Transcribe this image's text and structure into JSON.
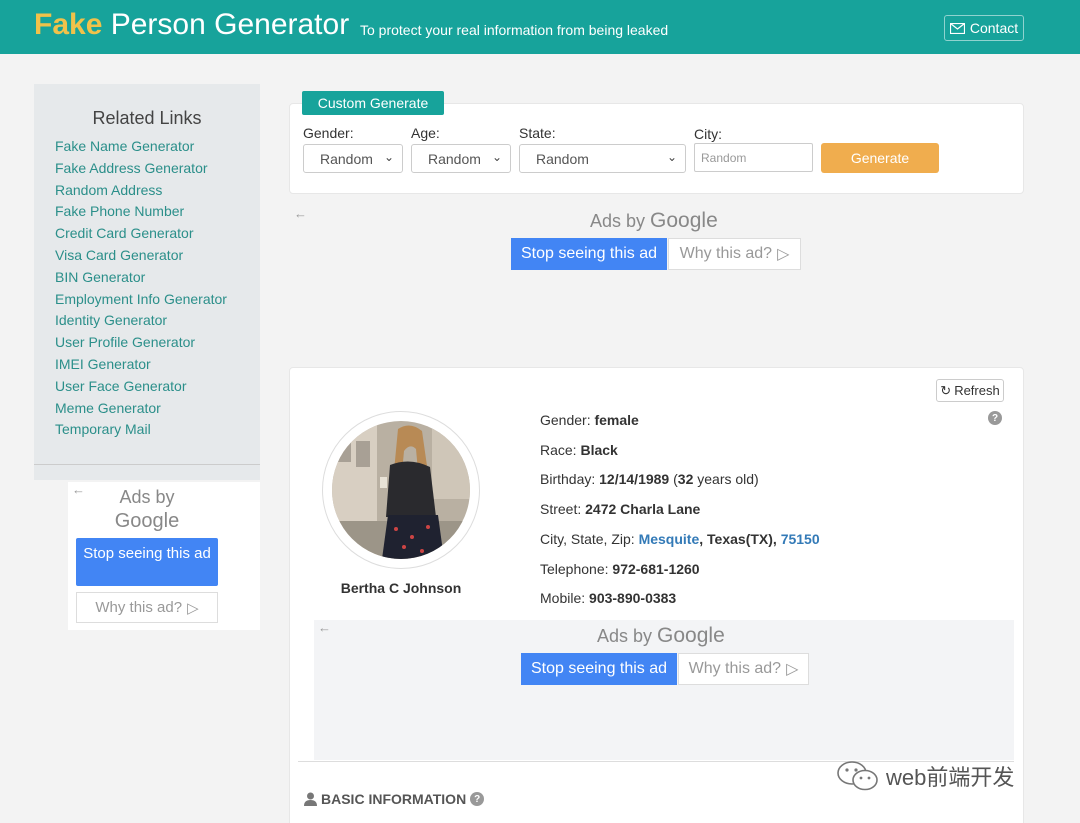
{
  "header": {
    "brand_fake": "Fake",
    "brand_rest": " Person Generator",
    "tagline": "To protect your real information from being leaked",
    "contact_label": "Contact"
  },
  "sidebar": {
    "title": "Related Links",
    "links": [
      "Fake Name Generator",
      "Fake Address Generator",
      "Random Address",
      "Fake Phone Number",
      "Credit Card Generator",
      "Visa Card Generator",
      "BIN Generator",
      "Employment Info Generator",
      "Identity Generator",
      "User Profile Generator",
      "IMEI Generator",
      "User Face Generator",
      "Meme Generator",
      "Temporary Mail"
    ]
  },
  "ads": {
    "ads_by": "Ads by",
    "google": "Google",
    "stop": "Stop seeing this ad",
    "why": "Why this ad?"
  },
  "form": {
    "tab": "Custom Generate",
    "gender_label": "Gender:",
    "gender_value": "Random",
    "age_label": "Age:",
    "age_value": "Random",
    "state_label": "State:",
    "state_value": "Random",
    "city_label": "City:",
    "city_placeholder": "Random",
    "generate": "Generate"
  },
  "profile": {
    "refresh": "Refresh",
    "name": "Bertha C Johnson",
    "gender_label": "Gender:",
    "gender": "female",
    "race_label": "Race:",
    "race": "Black",
    "birthday_label": "Birthday:",
    "birthday": "12/14/1989",
    "age_open": " (",
    "age": "32",
    "age_suffix": " years old)",
    "street_label": "Street:",
    "street": "2472 Charla Lane",
    "city_label": "City, State, Zip:",
    "city": "Mesquite",
    "state": "Texas(TX)",
    "zip": "75150",
    "telephone_label": "Telephone:",
    "telephone": "972-681-1260",
    "mobile_label": "Mobile:",
    "mobile": "903-890-0383"
  },
  "section": {
    "basic_info": "BASIC INFORMATION"
  },
  "watermark": "web前端开发"
}
